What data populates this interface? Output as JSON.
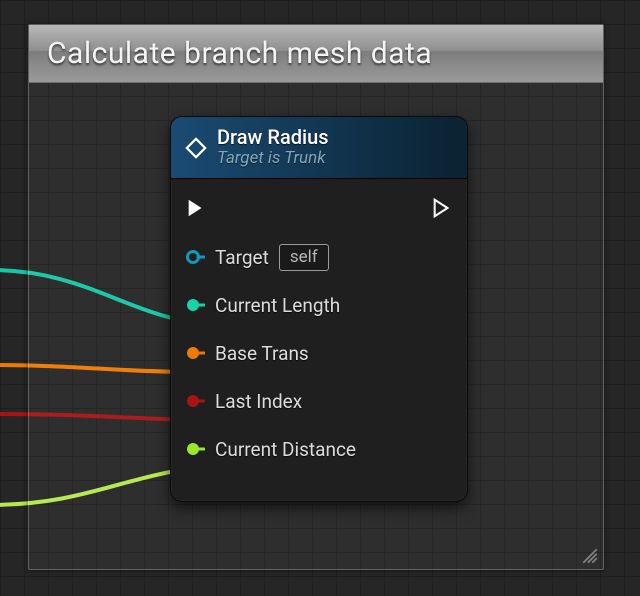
{
  "comment": {
    "title": "Calculate branch mesh data"
  },
  "node": {
    "title": "Draw Radius",
    "subtitle": "Target is Trunk",
    "pins": {
      "target": {
        "label": "Target",
        "default": "self",
        "color": "#1597b8"
      },
      "current_length": {
        "label": "Current Length",
        "color": "#19d3a2"
      },
      "base_trans": {
        "label": "Base Trans",
        "color": "#f07a00"
      },
      "last_index": {
        "label": "Last Index",
        "color": "#a81414"
      },
      "current_distance": {
        "label": "Current Distance",
        "color": "#9ae82c"
      }
    }
  },
  "wire_colors": {
    "teal": "#14c7a6",
    "orange": "#f07a00",
    "red": "#a81414",
    "lime": "#b6e94c"
  }
}
